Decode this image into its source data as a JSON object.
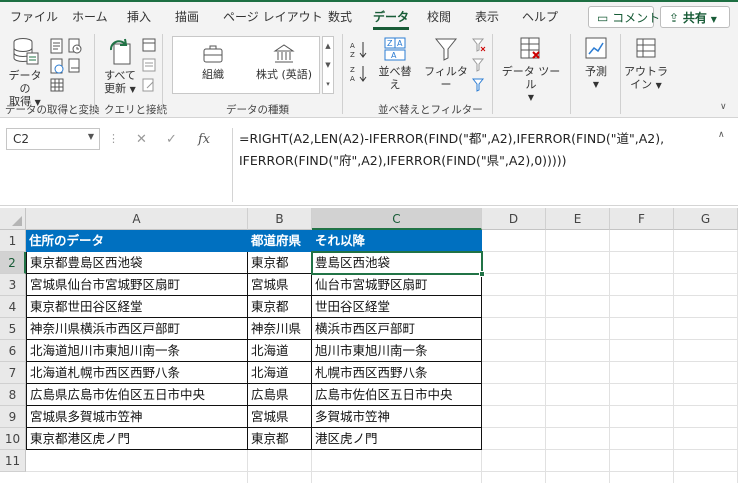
{
  "tabs": [
    {
      "label": "ファイル",
      "active": false
    },
    {
      "label": "ホーム",
      "active": false
    },
    {
      "label": "挿入",
      "active": false
    },
    {
      "label": "描画",
      "active": false
    },
    {
      "label": "ページ レイアウト",
      "active": false
    },
    {
      "label": "数式",
      "active": false
    },
    {
      "label": "データ",
      "active": true
    },
    {
      "label": "校閲",
      "active": false
    },
    {
      "label": "表示",
      "active": false
    },
    {
      "label": "ヘルプ",
      "active": false
    }
  ],
  "tab_actions": {
    "comment": "コメント",
    "share": "共有"
  },
  "ribbon": {
    "get_data_label": "データの",
    "get_data_label2": "取得",
    "group_get": "データの取得と変換",
    "refresh_label": "すべて",
    "refresh_label2": "更新",
    "group_query": "クエリと接続",
    "dt_org": "組織",
    "dt_stock": "株式 (英語)",
    "group_types": "データの種類",
    "sort_label": "並べ替え",
    "filter_label": "フィルター",
    "group_sort": "並べ替えとフィルター",
    "data_tools_label": "データ ツール",
    "forecast_label": "予測",
    "outline_label": "アウトラ",
    "outline_label2": "イン"
  },
  "formula_bar": {
    "name_box": "C2",
    "formula_line1": "=RIGHT(A2,LEN(A2)-IFERROR(FIND(\"都\",A2),IFERROR(FIND(\"道\",A2),",
    "formula_line2": "IFERROR(FIND(\"府\",A2),IFERROR(FIND(\"県\",A2),0)))))"
  },
  "columns": [
    "A",
    "B",
    "C",
    "D",
    "E",
    "F",
    "G"
  ],
  "rows": [
    "1",
    "2",
    "3",
    "4",
    "5",
    "6",
    "7",
    "8",
    "9",
    "10",
    "11"
  ],
  "table": {
    "headers": [
      "住所のデータ",
      "都道府県",
      "それ以降"
    ],
    "data": [
      [
        "東京都豊島区西池袋",
        "東京都",
        "豊島区西池袋"
      ],
      [
        "宮城県仙台市宮城野区扇町",
        "宮城県",
        "仙台市宮城野区扇町"
      ],
      [
        "東京都世田谷区経堂",
        "東京都",
        "世田谷区経堂"
      ],
      [
        "神奈川県横浜市西区戸部町",
        "神奈川県",
        "横浜市西区戸部町"
      ],
      [
        "北海道旭川市東旭川南一条",
        "北海道",
        "旭川市東旭川南一条"
      ],
      [
        "北海道札幌市西区西野八条",
        "北海道",
        "札幌市西区西野八条"
      ],
      [
        "広島県広島市佐伯区五日市中央",
        "広島県",
        "広島市佐伯区五日市中央"
      ],
      [
        "宮城県多賀城市笠神",
        "宮城県",
        "多賀城市笠神"
      ],
      [
        "東京都港区虎ノ門",
        "東京都",
        "港区虎ノ門"
      ]
    ]
  },
  "colors": {
    "header_fill": "#0070c0",
    "accent": "#217346"
  }
}
